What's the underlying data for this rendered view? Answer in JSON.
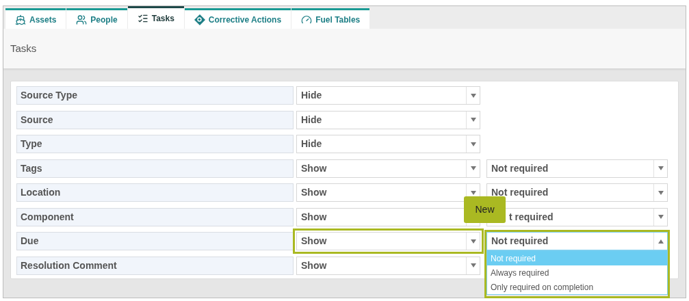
{
  "tabs": [
    {
      "label": "Assets",
      "selected": false
    },
    {
      "label": "People",
      "selected": false
    },
    {
      "label": "Tasks",
      "selected": true
    },
    {
      "label": "Corrective Actions",
      "selected": false
    },
    {
      "label": "Fuel Tables",
      "selected": false
    }
  ],
  "header": {
    "title": "Tasks"
  },
  "rows": [
    {
      "label": "Source Type",
      "visibility": {
        "value": "Hide"
      }
    },
    {
      "label": "Source",
      "visibility": {
        "value": "Hide"
      }
    },
    {
      "label": "Type",
      "visibility": {
        "value": "Hide"
      }
    },
    {
      "label": "Tags",
      "visibility": {
        "value": "Show"
      },
      "requirement": {
        "value": "Not required",
        "open": false
      }
    },
    {
      "label": "Location",
      "visibility": {
        "value": "Show"
      },
      "requirement": {
        "value": "Not required",
        "open": false
      }
    },
    {
      "label": "Component",
      "visibility": {
        "value": "Show"
      },
      "requirement": {
        "value": "t required",
        "open": false
      },
      "callout": "New"
    },
    {
      "label": "Due",
      "highlighted": true,
      "visibility": {
        "value": "Show"
      },
      "requirement": {
        "value": "Not required",
        "open": true,
        "options": [
          {
            "label": "Not required",
            "selected": true
          },
          {
            "label": "Always required",
            "selected": false
          },
          {
            "label": "Only required on completion",
            "selected": false
          }
        ]
      }
    },
    {
      "label": "Resolution Comment",
      "visibility": {
        "value": "Show"
      }
    }
  ]
}
